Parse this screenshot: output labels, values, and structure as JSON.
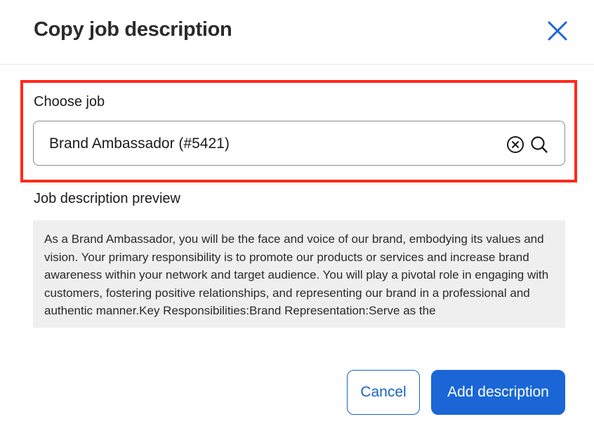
{
  "dialog": {
    "title": "Copy job description",
    "close_icon": "close-icon",
    "colors": {
      "accent": "#1a66d6",
      "highlight": "#ff2a1a",
      "preview_bg": "#efefef"
    }
  },
  "choose_job": {
    "label": "Choose job",
    "value": "Brand Ambassador (#5421)",
    "icons": [
      "clear-circle-icon",
      "search-icon"
    ]
  },
  "preview": {
    "label": "Job description preview",
    "text": "As a Brand Ambassador, you will be the face and voice of our brand, embodying its values and vision. Your primary responsibility is to promote our products or services and increase brand awareness within your network and target audience. You will play a pivotal role in engaging with customers, fostering positive relationships, and representing our brand in a professional and authentic manner.Key Responsibilities:Brand Representation:Serve as the"
  },
  "actions": {
    "cancel_label": "Cancel",
    "add_label": "Add description"
  }
}
